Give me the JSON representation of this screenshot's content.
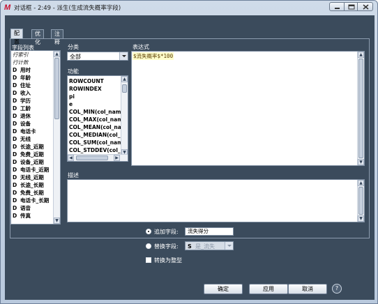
{
  "window": {
    "logo": "M",
    "title": "对话框 - 2:49 - 派生(生成流失概率字段)"
  },
  "tabs": [
    "配置",
    "优化",
    "注释"
  ],
  "fields": {
    "header": "字段列表",
    "items": [
      {
        "label": "行索引",
        "italic": true,
        "icon": ""
      },
      {
        "label": "行计数",
        "italic": true,
        "icon": ""
      },
      {
        "label": "用时",
        "icon": "D"
      },
      {
        "label": "年龄",
        "icon": "D"
      },
      {
        "label": "住址",
        "icon": "D"
      },
      {
        "label": "收入",
        "icon": "D"
      },
      {
        "label": "学历",
        "icon": "D"
      },
      {
        "label": "工龄",
        "icon": "D"
      },
      {
        "label": "退休",
        "icon": "D"
      },
      {
        "label": "设备",
        "icon": "D"
      },
      {
        "label": "电话卡",
        "icon": "D"
      },
      {
        "label": "无线",
        "icon": "D"
      },
      {
        "label": "长途_近期",
        "icon": "D"
      },
      {
        "label": "免费_近期",
        "icon": "D"
      },
      {
        "label": "设备_近期",
        "icon": "D"
      },
      {
        "label": "电话卡_近期",
        "icon": "D"
      },
      {
        "label": "无线_近期",
        "icon": "D"
      },
      {
        "label": "长途_长期",
        "icon": "D"
      },
      {
        "label": "免费_长期",
        "icon": "D"
      },
      {
        "label": "电话卡_长期",
        "icon": "D"
      },
      {
        "label": "语音",
        "icon": "D"
      },
      {
        "label": "传真",
        "icon": "D"
      }
    ]
  },
  "category": {
    "header": "分类",
    "selected": "全部"
  },
  "functions": {
    "header": "功能",
    "items": [
      "ROWCOUNT",
      "ROWINDEX",
      "pi",
      "e",
      "COL_MIN(col_name)",
      "COL_MAX(col_name)",
      "COL_MEAN(col_name)",
      "COL_MEDIAN(col_name)",
      "COL_SUM(col_name)",
      "COL_STDDEV(col_name)"
    ]
  },
  "expression": {
    "header": "表达式",
    "value": "$流失概率$*100"
  },
  "description": {
    "header": "描述"
  },
  "options": {
    "append_label": "追加字段:",
    "append_value": "流失得分",
    "append_selected": true,
    "replace_label": "替换字段:",
    "replace_icon": "S",
    "replace_value": "是_流失",
    "replace_selected": false,
    "convert_label": "转换为整型",
    "convert_checked": false
  },
  "buttons": {
    "ok": "确定",
    "apply": "应用",
    "cancel": "取消",
    "help": "?"
  },
  "colors": {
    "client_bg": "#3b4b5c",
    "logo": "#c8102e",
    "expression_highlight": "#ffffcc"
  }
}
